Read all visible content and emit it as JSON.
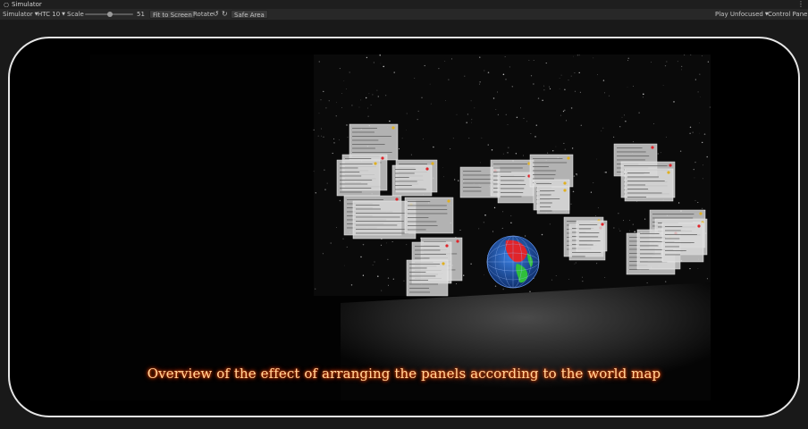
{
  "window": {
    "tab_label": "Simulator"
  },
  "toolbar": {
    "view_dropdown": "Simulator",
    "device_dropdown": "HTC 10",
    "scale_label": "Scale",
    "scale_value": "51",
    "scale_fraction": 0.51,
    "fit_button": "Fit to Screen",
    "rotate_label": "Rotate",
    "safe_area_button": "Safe Area",
    "play_mode_dropdown": "Play Unfocused",
    "control_panel_button": "Control Panel"
  },
  "game_view": {
    "caption": "Overview of the effect of arranging the panels according to the world map"
  },
  "colors": {
    "caption_glow": "#ff5a00",
    "device_frame": "#e6e6e6",
    "globe_ocean": "#1f5fc8",
    "globe_land": "#2fbf3a",
    "globe_highlight": "#e0242a"
  }
}
